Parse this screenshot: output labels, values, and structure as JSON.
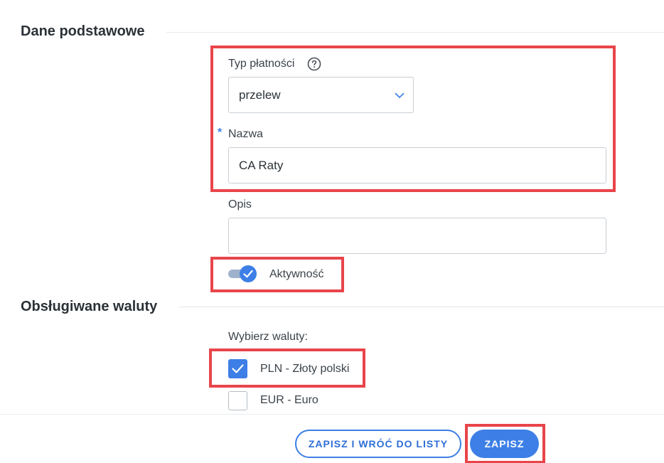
{
  "sections": {
    "basic": "Dane podstawowe",
    "currencies": "Obsługiwane waluty"
  },
  "form": {
    "payment_type_label": "Typ płatności",
    "payment_type_value": "przelew",
    "name_label": "Nazwa",
    "name_value": "CA Raty",
    "description_label": "Opis",
    "description_value": "",
    "activity_label": "Aktywność",
    "activity_on": true
  },
  "currencies": {
    "prompt": "Wybierz waluty:",
    "items": [
      {
        "label": "PLN - Złoty polski",
        "checked": true
      },
      {
        "label": "EUR - Euro",
        "checked": false
      }
    ]
  },
  "footer": {
    "save_and_return": "ZAPISZ I WRÓĆ DO LISTY",
    "save": "ZAPISZ"
  },
  "colors": {
    "accent": "#3d7fe6",
    "highlight": "#e8454a"
  },
  "icons": {
    "help": "question-circle-icon",
    "dropdown": "chevron-down-icon",
    "check": "checkmark-icon"
  }
}
